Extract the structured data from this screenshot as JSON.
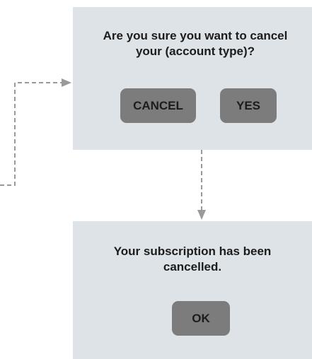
{
  "confirm_dialog": {
    "message_line1": "Are you sure you want to cancel",
    "message_line2": "your (account type)?",
    "cancel_label": "CANCEL",
    "yes_label": "YES"
  },
  "cancelled_dialog": {
    "message_line1": "Your subscription has been",
    "message_line2": "cancelled.",
    "ok_label": "OK"
  },
  "colors": {
    "panel_background": "#dde3e6",
    "button_fill": "#7c7c7c",
    "connector": "#9a9a9a",
    "text": "#1c1c1c"
  }
}
